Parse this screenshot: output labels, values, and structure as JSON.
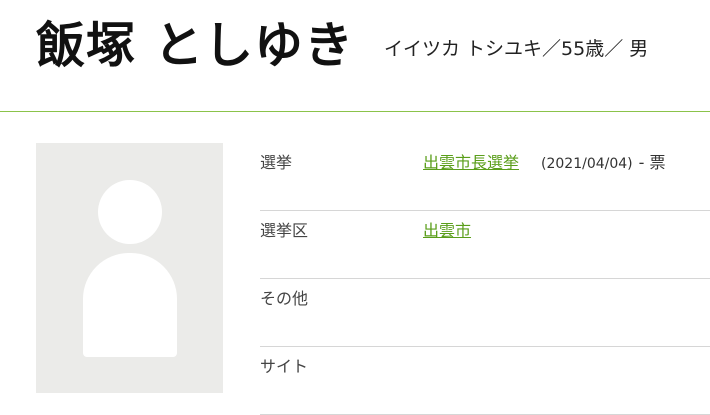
{
  "candidate": {
    "name": "飯塚 としゆき",
    "meta": "イイツカ トシユキ／55歳／ 男"
  },
  "details": {
    "election_label": "選挙",
    "election_link": "出雲市長選挙",
    "election_date": "(2021/04/04)",
    "election_votes": "- 票",
    "district_label": "選挙区",
    "district_link": "出雲市",
    "other_label": "その他",
    "site_label": "サイト"
  },
  "colors": {
    "accent": "#8bc34a",
    "link": "#5a9e1a",
    "placeholder_bg": "#ebebe9"
  }
}
